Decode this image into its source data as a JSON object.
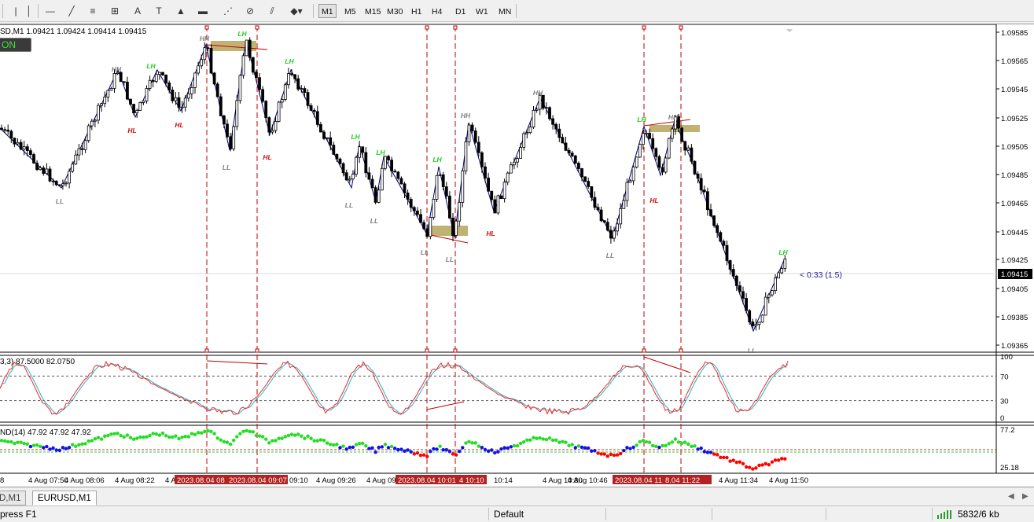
{
  "toolbar": {
    "tools": [
      "cursor-icon",
      "vertical-line-icon",
      "horizontal-line-icon",
      "trendline-icon",
      "fibonacci-icon",
      "grid-icon",
      "text-icon",
      "text-label-icon",
      "triangle-icon",
      "rectangle-icon",
      "fib-fan-icon",
      "arrows-icon",
      "channel-icon",
      "shapes-dropdown-icon"
    ],
    "timeframes": [
      "M1",
      "M5",
      "M15",
      "M30",
      "H1",
      "H4",
      "D1",
      "W1",
      "MN"
    ],
    "active_timeframe": "M1"
  },
  "chart": {
    "symbol_header": "SD,M1  1.09421 1.09424 1.09414 1.09415",
    "on_badge": "ON",
    "bid_price": "1.09415",
    "countdown": "< 0:33 (1.5)",
    "price_axis": [
      "1.09585",
      "1.09565",
      "1.09545",
      "1.09525",
      "1.09505",
      "1.09485",
      "1.09465",
      "1.09445",
      "1.09425",
      "1.09405",
      "1.09385",
      "1.09365"
    ],
    "swing_labels": [
      {
        "text": "HH",
        "color": "#808080"
      },
      {
        "text": "LH",
        "color": "#19d119"
      },
      {
        "text": "HH",
        "color": "#808080"
      },
      {
        "text": "LH",
        "color": "#19d119"
      },
      {
        "text": "HL",
        "color": "#cc1111"
      },
      {
        "text": "HL",
        "color": "#cc1111"
      },
      {
        "text": "LH",
        "color": "#19d119"
      },
      {
        "text": "LL",
        "color": "#808080"
      },
      {
        "text": "LL",
        "color": "#808080"
      },
      {
        "text": "HL",
        "color": "#cc1111"
      },
      {
        "text": "LH",
        "color": "#19d119"
      },
      {
        "text": "LH",
        "color": "#19d119"
      },
      {
        "text": "LL",
        "color": "#808080"
      },
      {
        "text": "LL",
        "color": "#808080"
      },
      {
        "text": "LH",
        "color": "#19d119"
      },
      {
        "text": "HH",
        "color": "#808080"
      },
      {
        "text": "LL",
        "color": "#808080"
      },
      {
        "text": "LL",
        "color": "#808080"
      },
      {
        "text": "HL",
        "color": "#cc1111"
      },
      {
        "text": "HH",
        "color": "#808080"
      },
      {
        "text": "LL",
        "color": "#808080"
      },
      {
        "text": "LH",
        "color": "#19d119"
      },
      {
        "text": "HH",
        "color": "#808080"
      },
      {
        "text": "HL",
        "color": "#cc1111"
      },
      {
        "text": "LH",
        "color": "#19d119"
      },
      {
        "text": "LL",
        "color": "#808080"
      }
    ]
  },
  "stoch": {
    "label": "3,3) 87.5000 82.0750",
    "levels": [
      "100",
      "70",
      "30",
      "0"
    ]
  },
  "indicator2": {
    "label": "ND(14) 47.92 47.92 47.92",
    "levels": [
      "77.2",
      "25.18"
    ]
  },
  "time_axis": {
    "labels": [
      "8",
      "4 Aug 07:50",
      "4 Aug 08:06",
      "4 Aug 08:22",
      "4 A",
      "09:10",
      "4 Aug 09:26",
      "4 Aug 09",
      "10:14",
      "4 Aug 10:30",
      "4 Aug 10:46",
      "4 Aug 11:34",
      "4 Aug 11:50"
    ],
    "highlights": [
      "2023.08.04 08",
      "2023.08.04 09:07",
      "2023.08.04 10:01",
      "4 10:10",
      "2023.08.04 11:10",
      "8.04 11:22"
    ]
  },
  "tabs": {
    "items": [
      "D,M1",
      "EURUSD,M1"
    ],
    "active": 1
  },
  "status": {
    "help": " press F1",
    "profile": "Default",
    "traffic": "5832/6 kb"
  },
  "colors": {
    "candle": "#000000",
    "zigzag": "#000080",
    "vline": "#c00000",
    "zone": "#b5a45a",
    "stoch_main": "#ff2020",
    "stoch_signal": "#1fb5c8",
    "dot_red": "#ff0000",
    "dot_green": "#22dd22",
    "dot_blue": "#1010ee"
  }
}
